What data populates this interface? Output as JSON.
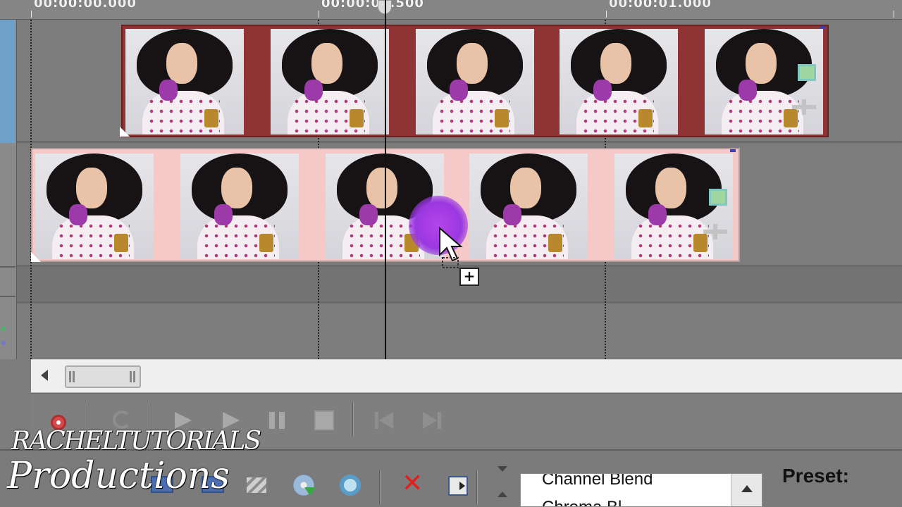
{
  "timeline": {
    "ruler_labels": [
      "00:00:00.000",
      "00:00:00.500",
      "00:00:01.000"
    ],
    "tracks": [
      {
        "name": "video-track-1",
        "clip_color": "#8e3434",
        "thumbnail_count": 5
      },
      {
        "name": "video-track-2",
        "clip_color": "#f6c9c9",
        "thumbnail_count": 5
      }
    ],
    "drag_badge": "+"
  },
  "transport": {
    "buttons": [
      "record",
      "loop",
      "play-from-start",
      "play",
      "pause",
      "stop",
      "go-to-start",
      "go-to-end"
    ]
  },
  "bottom_toolbar": {
    "icons": [
      "film-icon",
      "arrows-icon",
      "disc-export-icon",
      "search-icon",
      "delete-icon",
      "properties-icon"
    ],
    "dropdown_items": [
      "Channel Blend",
      "Chroma Bl"
    ],
    "preset_label": "Preset:"
  },
  "watermark": {
    "line1": "RACHELTUTORIALS",
    "line2": "Productions"
  },
  "colors": {
    "background": "#7d7d7d",
    "accent_blue": "#6fa0c8",
    "record_red": "#d34a4a",
    "drag_purple": "#9a38e0"
  }
}
